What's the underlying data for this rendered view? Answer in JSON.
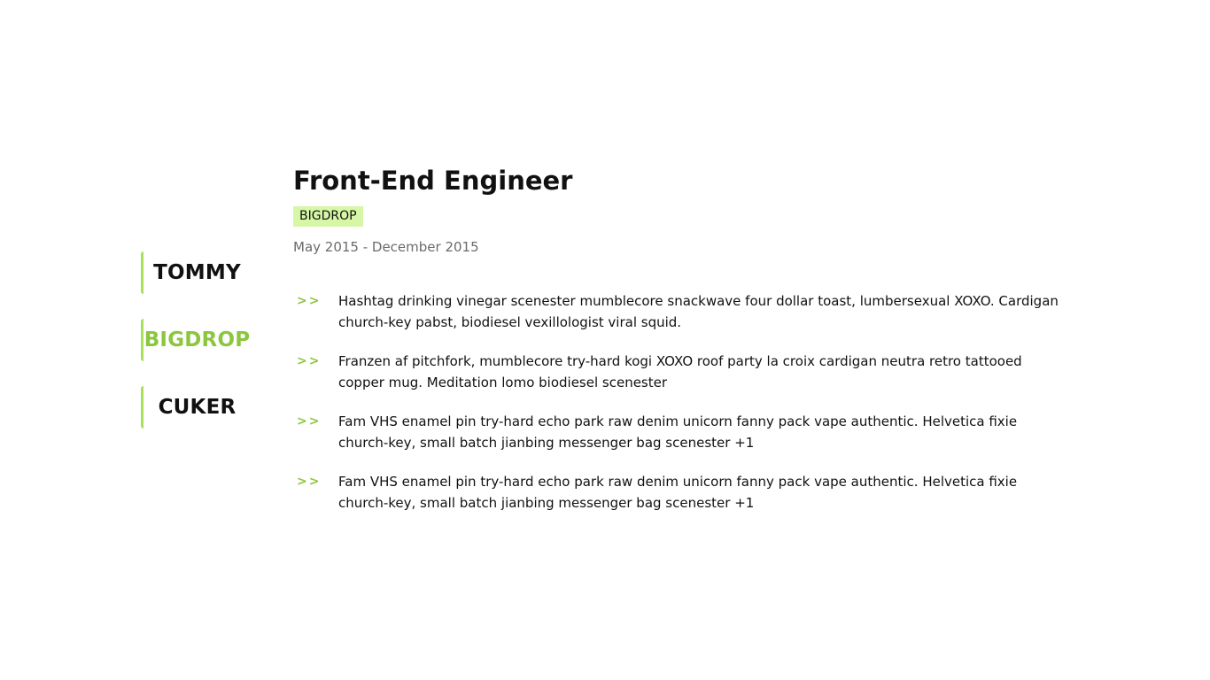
{
  "tabs": {
    "items": [
      {
        "label": "TOMMY",
        "active": false
      },
      {
        "label": "BIGDROP",
        "active": true
      },
      {
        "label": "CUKER",
        "active": false
      }
    ]
  },
  "job": {
    "title": "Front-End Engineer",
    "company": "BIGDROP",
    "dates": "May 2015 - December 2015",
    "marker": ">>",
    "bullets": [
      "Hashtag drinking vinegar scenester mumblecore snackwave four dollar toast, lumbersexual XOXO. Cardigan church-key pabst, biodiesel vexillologist viral squid.",
      "Franzen af pitchfork, mumblecore try-hard kogi XOXO roof party la croix cardigan neutra retro tattooed copper mug. Meditation lomo biodiesel scenester",
      "Fam VHS enamel pin try-hard echo park raw denim unicorn fanny pack vape authentic. Helvetica fixie church-key, small batch jianbing messenger bag scenester +1",
      "Fam VHS enamel pin try-hard echo park raw denim unicorn fanny pack vape authentic. Helvetica fixie church-key, small batch jianbing messenger bag scenester +1"
    ]
  },
  "colors": {
    "accent": "#8cc63f",
    "tab_border": "#a8e05a",
    "badge_bg": "#d6f7a5",
    "muted_text": "#6b6b6b"
  }
}
